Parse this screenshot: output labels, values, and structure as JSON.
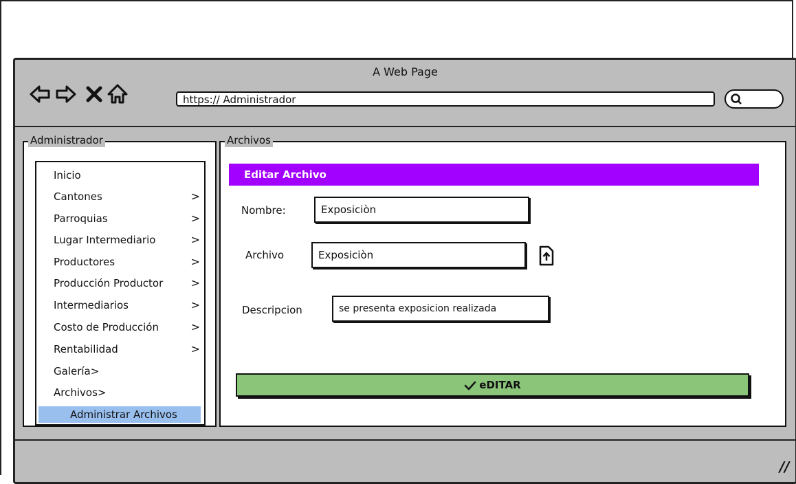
{
  "window": {
    "title": "A Web Page",
    "url": "https:// Administrador"
  },
  "nav_icons": [
    "back-arrow-icon",
    "forward-arrow-icon",
    "close-x-icon",
    "home-icon",
    "search-icon"
  ],
  "sidebar": {
    "title": "Administrador",
    "items": [
      {
        "label": "Inicio",
        "chevron": ""
      },
      {
        "label": "Cantones",
        "chevron": ">"
      },
      {
        "label": "Parroquias",
        "chevron": ">"
      },
      {
        "label": "Lugar Intermediario",
        "chevron": ">"
      },
      {
        "label": "Productores",
        "chevron": ">"
      },
      {
        "label": "Producción Productor",
        "chevron": ">"
      },
      {
        "label": "Intermediarios",
        "chevron": ">"
      },
      {
        "label": "Costo de Producción",
        "chevron": ">"
      },
      {
        "label": "Rentabilidad",
        "chevron": ">"
      },
      {
        "label": "Galería>",
        "chevron": ""
      },
      {
        "label": "Archivos>",
        "chevron": ""
      },
      {
        "label": "Administrar Archivos",
        "chevron": ""
      }
    ],
    "active_item": "Administrar Archivos"
  },
  "main": {
    "title": "Archivos",
    "header": "Editar Archivo",
    "form": {
      "nombre_label": "Nombre:",
      "nombre_value": "Exposiciòn",
      "archivo_label": "Archivo",
      "archivo_value": "Exposiciòn",
      "descripcion_label": "Descripcion",
      "descripcion_value": "se presenta exposicion realizada"
    },
    "submit_label": "eDITAR"
  },
  "colors": {
    "header_bg": "#a200ff",
    "button_bg": "#8bc57a",
    "active_item_bg": "#99bfee",
    "chrome_bg": "#bdbdbd"
  }
}
